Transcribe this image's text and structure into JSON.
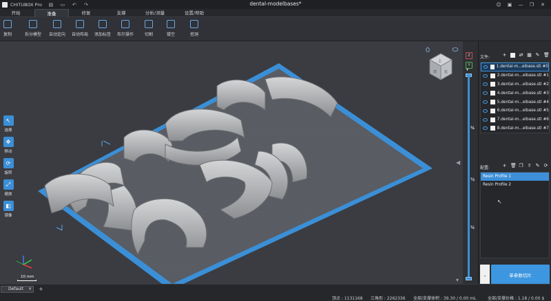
{
  "app": {
    "name": "CHITUBOX Pro",
    "document_title": "dental-modelbases*"
  },
  "title_bar": {
    "icons": [
      "file-icon",
      "folder-icon",
      "undo-icon",
      "redo-icon"
    ],
    "window_controls": [
      "user-icon",
      "presentation-icon",
      "minimize-icon",
      "restore-icon",
      "close-icon"
    ]
  },
  "menu": {
    "tabs": [
      "开始",
      "准备",
      "修复",
      "支撑",
      "分析/测量",
      "设置/帮助"
    ],
    "active": "准备"
  },
  "toolbar": {
    "tools": [
      "复制",
      "拆分模型",
      "自动定向",
      "自动布局",
      "添加标签",
      "布尔操作",
      "切割",
      "镂空",
      "挖洞"
    ]
  },
  "side_tools": [
    "选择",
    "移动",
    "旋转",
    "缩放",
    "镜像"
  ],
  "scale": {
    "label": "10 mm"
  },
  "slider": {
    "fractions": [
      "¾",
      "½",
      "¼"
    ],
    "axis_labels": [
      "Z",
      "Y"
    ]
  },
  "files": {
    "header": "文件:",
    "items": [
      "1.dental-m...elbase.stl #0",
      "2.dental-m...elbase.stl #1",
      "3.dental-m...elbase.stl #2",
      "4.dental-m...elbase.stl #3",
      "5.dental-m...elbase.stl #4",
      "6.dental-m...elbase.stl #5",
      "7.dental-m...elbase.stl #6",
      "8.dental-m...elbase.stl #7"
    ],
    "selected_index": 0
  },
  "profiles": {
    "header": "配置:",
    "items": [
      "Resin Profile 1",
      "Resin Profile 2"
    ],
    "selected_index": 0
  },
  "slice": {
    "minus": "-",
    "button": "单参数切片"
  },
  "plate": {
    "tab": "Default",
    "add": "+"
  },
  "stats": {
    "vertices": "顶点 : 1131168",
    "triangles": "三角形 : 2262336",
    "volume": "全部/支撑体积 : 39.30 / 0.00 mL",
    "price": "全部/支撑价格 : 1.18 / 0.00 $"
  },
  "colors": {
    "accent": "#3d8fd8",
    "build_plate": "#3b8fd6",
    "model": "#b9babc"
  },
  "view_cube": {
    "face_labels": [
      "上",
      "前",
      "右"
    ]
  }
}
